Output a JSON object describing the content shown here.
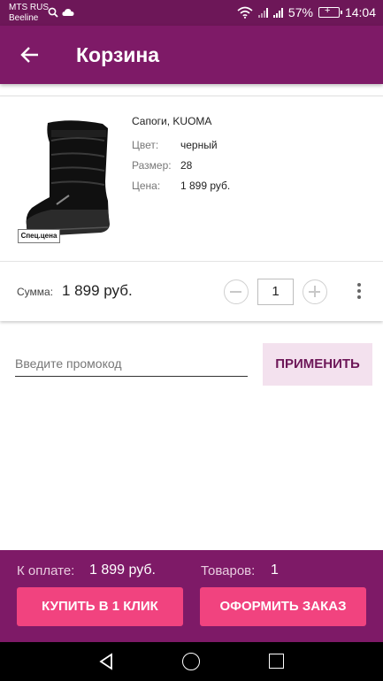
{
  "status_bar": {
    "carrier_1": "MTS RUS",
    "carrier_2": "Beeline",
    "battery": "57%",
    "time": "14:04"
  },
  "app_bar": {
    "title": "Корзина",
    "back_icon": "arrow-left-icon"
  },
  "cart_item": {
    "name": "Сапоги, KUOMA",
    "badge": "Спец.цена",
    "attributes": [
      {
        "label": "Цвет:",
        "value": "черный"
      },
      {
        "label": "Размер:",
        "value": "28"
      },
      {
        "label": "Цена:",
        "value": "1 899 руб."
      }
    ],
    "sum_label": "Сумма:",
    "sum_value": "1 899 руб.",
    "quantity": "1"
  },
  "promo": {
    "placeholder": "Введите промокод",
    "apply_label": "ПРИМЕНИТЬ"
  },
  "checkout": {
    "pay_label": "К оплате:",
    "pay_value": "1 899 руб.",
    "count_label": "Товаров:",
    "count_value": "1",
    "one_click_label": "КУПИТЬ В 1 КЛИК",
    "checkout_label": "ОФОРМИТЬ ЗАКАЗ"
  },
  "colors": {
    "primary": "#7e1a67",
    "status_bar": "#6d1758",
    "accent": "#f1437f",
    "promo_button_bg": "#f3e1ee"
  }
}
